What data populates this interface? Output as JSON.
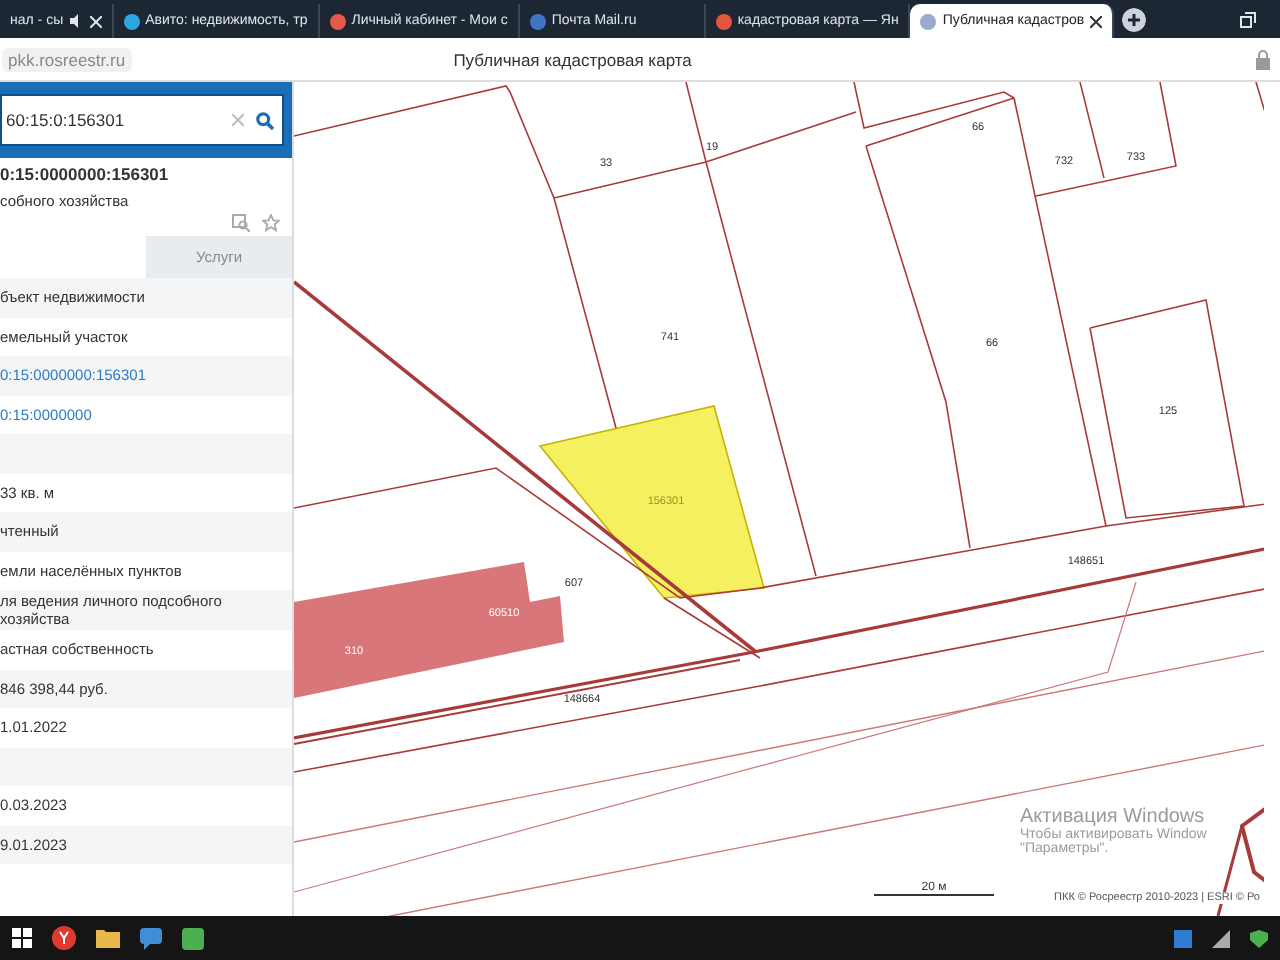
{
  "browser": {
    "tabs": [
      {
        "title": "нал - сы",
        "selected": false,
        "audio": true
      },
      {
        "title": "Авито: недвижимость, тр",
        "selected": false
      },
      {
        "title": "Личный кабинет - Мои с",
        "selected": false
      },
      {
        "title": "Почта Mail.ru",
        "selected": false
      },
      {
        "title": "кадастровая карта — Ян",
        "selected": false
      },
      {
        "title": "Публичная кадастров",
        "selected": true
      }
    ],
    "address": "pkk.rosreestr.ru",
    "page_title": "Публичная кадастровая карта"
  },
  "sidebar": {
    "search": {
      "value": "60:15:0:156301"
    },
    "object": {
      "number": "0:15:0000000:156301",
      "subtitle": "собного хозяйства"
    },
    "tabs": [
      {
        "label": "Услуги",
        "selected": false
      }
    ],
    "rows": [
      {
        "kind": "text",
        "text": "бъект недвижимости"
      },
      {
        "kind": "text",
        "text": "емельный участок"
      },
      {
        "kind": "link",
        "text": "0:15:0000000:156301"
      },
      {
        "kind": "link",
        "text": "0:15:0000000"
      },
      {
        "kind": "blank"
      },
      {
        "kind": "text",
        "text": "33 кв. м"
      },
      {
        "kind": "text",
        "text": "чтенный"
      },
      {
        "kind": "text",
        "text": "емли населённых пунктов"
      },
      {
        "kind": "text",
        "text": "ля ведения личного подсобного хозяйства"
      },
      {
        "kind": "text",
        "text": "астная собственность"
      },
      {
        "kind": "text",
        "text": " 846 398,44 руб."
      },
      {
        "kind": "text",
        "text": "1.01.2022"
      },
      {
        "kind": "blank"
      },
      {
        "kind": "text",
        "text": "0.03.2023"
      },
      {
        "kind": "text",
        "text": "9.01.2023"
      }
    ]
  },
  "map": {
    "labels": [
      {
        "text": "33",
        "kind": "parcel"
      },
      {
        "text": "19",
        "kind": "parcel"
      },
      {
        "text": "66",
        "kind": "parcel"
      },
      {
        "text": "732",
        "kind": "parcel"
      },
      {
        "text": "733",
        "kind": "parcel"
      },
      {
        "text": "741",
        "kind": "parcel"
      },
      {
        "text": "66",
        "kind": "parcel"
      },
      {
        "text": "125",
        "kind": "parcel"
      },
      {
        "text": "156301",
        "kind": "selected"
      },
      {
        "text": "148651",
        "kind": "parcel"
      },
      {
        "text": "607",
        "kind": "parcel"
      },
      {
        "text": "148664",
        "kind": "parcel"
      },
      {
        "text": "60510",
        "kind": "building"
      },
      {
        "text": "310",
        "kind": "building"
      }
    ],
    "scale": "20 м",
    "copyright": "ПКК © Росреестр 2010-2023 | ESRI © Ро",
    "activation": {
      "title": "Активация Windows",
      "text": "Чтобы активировать Window",
      "link": "\"Параметры\"."
    }
  }
}
